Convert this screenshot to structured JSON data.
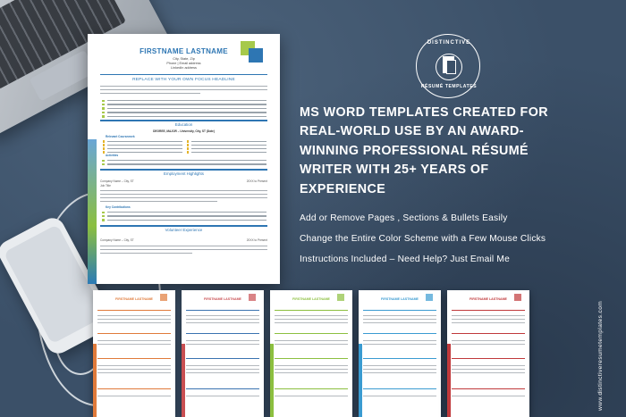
{
  "main_resume": {
    "name": "FIRSTNAME LASTNAME",
    "contact_lines": [
      "City, State, Zip",
      "Phone | Email address",
      "LinkedIn address"
    ],
    "headline": "REPLACE WITH YOUR OWN FOCUS HEADLINE",
    "sections": [
      "Education",
      "Employment Highlights",
      "Volunteer Experience"
    ],
    "degree_line": "DEGREE, MAJOR – University, City, ST (Date)",
    "subheads": [
      "Relevant Coursework",
      "Activities",
      "Key Contributions"
    ],
    "employer_line_1": "Company Name – City, ST",
    "date_range": "20XX to Present",
    "job_title": "Job Title",
    "employer_line_2": "Company Name – City, ST",
    "date_range_2": "20XX to Present"
  },
  "logo": {
    "top_text": "DISTINCTIVE",
    "bottom_text": "RÉSUMÉ TEMPLATES"
  },
  "headline": "MS WORD TEMPLATES CREATED FOR REAL-WORLD USE BY AN AWARD-WINNING PROFESSIONAL RÉSUMÉ WRITER WITH 25+ YEARS OF EXPERIENCE",
  "features": [
    "Add or Remove Pages , Sections & Bullets Easily",
    "Change the Entire Color Scheme with a Few Mouse Clicks",
    "Instructions Included – Need Help? Just Email Me"
  ],
  "website": "www.distinctiveresumetemplates.com",
  "thumbnails": [
    {
      "name": "FIRSTNAME LASTNAME",
      "color": "#e07a3a"
    },
    {
      "name": "FIRSTNAME LASTNAME",
      "color": "#c94f52"
    },
    {
      "name": "FIRSTNAME LASTNAME",
      "color": "#8cbf3f"
    },
    {
      "name": "FIRSTNAME LASTNAME",
      "color": "#3a9bd1"
    },
    {
      "name": "FIRSTNAME LASTNAME",
      "color": "#c0393b"
    }
  ],
  "colors": {
    "background": "#3b5068",
    "resume_accent": "#2e76b3",
    "resume_green": "#a6c94b"
  }
}
